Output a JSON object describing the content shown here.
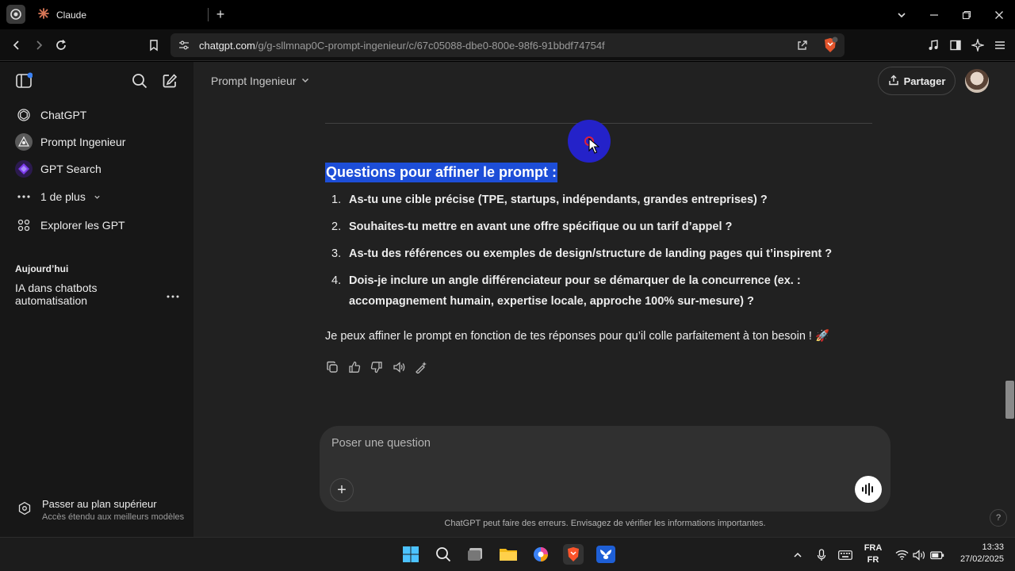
{
  "browser": {
    "tab_title": "Claude",
    "url_host": "chatgpt.com",
    "url_path": "/g/g-sllmnap0C-prompt-ingenieur/c/67c05088-dbe0-800e-98f6-91bbdf74754f"
  },
  "sidebar": {
    "items": [
      {
        "label": "ChatGPT",
        "icon": "openai-logo-icon"
      },
      {
        "label": "Prompt Ingenieur",
        "icon": "gpt-avatar-icon"
      },
      {
        "label": "GPT Search",
        "icon": "gpt-search-icon"
      },
      {
        "label": "1 de plus",
        "icon": "more-dots-icon"
      },
      {
        "label": "Explorer les GPT",
        "icon": "grid-icon"
      }
    ],
    "section_today": "Aujourd’hui",
    "conversation": "IA dans chatbots automatisation",
    "upgrade_title": "Passer au plan supérieur",
    "upgrade_subtitle": "Accès étendu aux meilleurs modèles"
  },
  "header": {
    "model_name": "Prompt Ingenieur",
    "share_label": "Partager"
  },
  "message": {
    "heading": "Questions pour affiner le prompt :",
    "questions": [
      {
        "num": "1.",
        "text": "As-tu une cible précise (TPE, startups, indépendants, grandes entreprises) ?"
      },
      {
        "num": "2.",
        "text": "Souhaites-tu mettre en avant une offre spécifique ou un tarif d’appel ?"
      },
      {
        "num": "3.",
        "text": "As-tu des références ou exemples de design/structure de landing pages qui t’inspirent ?"
      },
      {
        "num": "4.",
        "text": "Dois-je inclure un angle différenciateur pour se démarquer de la concurrence (ex. : accompagnement humain, expertise locale, approche 100% sur-mesure) ?"
      }
    ],
    "closing": "Je peux affiner le prompt en fonction de tes réponses pour qu’il colle parfaitement à ton besoin ! 🚀"
  },
  "composer": {
    "placeholder": "Poser une question"
  },
  "disclaimer": "ChatGPT peut faire des erreurs. Envisagez de vérifier les informations importantes.",
  "help_label": "?",
  "taskbar": {
    "lang_line1": "FRA",
    "lang_line2": "FR",
    "time": "13:33",
    "date": "27/02/2025"
  },
  "colors": {
    "accent_highlight": "#1d4ed8",
    "main_bg": "#212121",
    "sidebar_bg": "#171717"
  }
}
